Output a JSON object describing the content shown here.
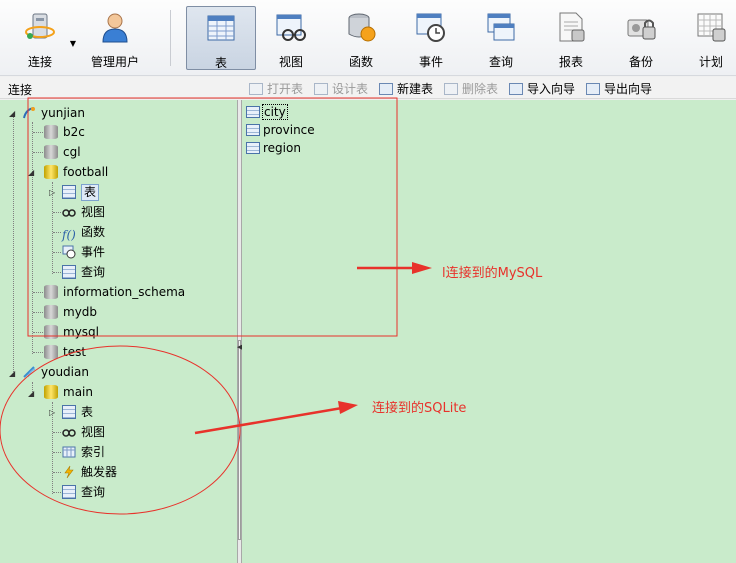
{
  "toolbar": {
    "buttons": [
      {
        "label": "连接",
        "icon": "connection-icon"
      },
      {
        "label": "管理用户",
        "icon": "user-icon"
      },
      {
        "label": "表",
        "icon": "table-icon",
        "active": true
      },
      {
        "label": "视图",
        "icon": "view-icon"
      },
      {
        "label": "函数",
        "icon": "function-icon"
      },
      {
        "label": "事件",
        "icon": "event-icon"
      },
      {
        "label": "查询",
        "icon": "query-icon"
      },
      {
        "label": "报表",
        "icon": "report-icon"
      },
      {
        "label": "备份",
        "icon": "backup-icon"
      },
      {
        "label": "计划",
        "icon": "schedule-icon"
      }
    ]
  },
  "subbar": {
    "connection_label": "连接",
    "actions": [
      {
        "label": "打开表",
        "enabled": false
      },
      {
        "label": "设计表",
        "enabled": false
      },
      {
        "label": "新建表",
        "enabled": true
      },
      {
        "label": "删除表",
        "enabled": false
      },
      {
        "label": "导入向导",
        "enabled": true
      },
      {
        "label": "导出向导",
        "enabled": true
      }
    ]
  },
  "tree": {
    "conn1": {
      "name": "yunjian"
    },
    "conn1_dbs": [
      "b2c",
      "cgl",
      "football",
      "information_schema",
      "mydb",
      "mysql",
      "test"
    ],
    "football_children": [
      "表",
      "视图",
      "函数",
      "事件",
      "查询"
    ],
    "conn2": {
      "name": "youdian"
    },
    "conn2_db": "main",
    "main_children": [
      "表",
      "视图",
      "索引",
      "触发器",
      "查询"
    ]
  },
  "tables": [
    "city",
    "province",
    "region"
  ],
  "annotations": {
    "mysql": "l连接到的MySQL",
    "sqlite": "连接到的SQLite",
    "color": "#e8322b"
  },
  "colors": {
    "panel_bg": "#c9ebcb",
    "accent": "#e8322b"
  }
}
